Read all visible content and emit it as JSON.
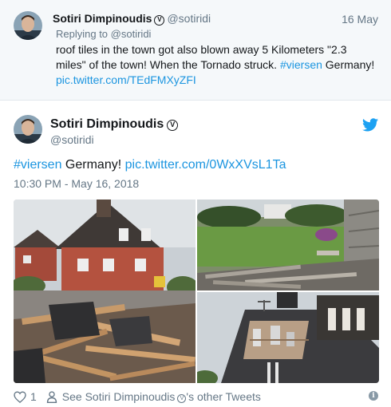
{
  "parent_tweet": {
    "author_name": "Sotiri Dimpinoudis",
    "verified_glyph": "Ⓥ",
    "author_handle": "@sotiridi",
    "date": "16 May",
    "replying_prefix": "Replying to",
    "replying_to": "@sotiridi",
    "text_line1": "roof tiles in the town got also blown away 5 Kilometers \"2.3",
    "text_line2_a": "miles\" of the town! When the Tornado struck. ",
    "hashtag": "#viersen",
    "text_line2_b": " Germany!",
    "link": "pic.twitter.com/TEdFMXyZFI"
  },
  "tweet": {
    "author_name": "Sotiri Dimpinoudis",
    "verified_glyph": "Ⓥ",
    "author_handle": "@sotiridi",
    "hashtag": "#viersen",
    "text_middle": " Germany! ",
    "link": "pic.twitter.com/0WxXVsL1Ta",
    "timestamp": "10:30 PM - May 16, 2018"
  },
  "actions": {
    "like_count": "1",
    "other_tweets_prefix": "See Sotiri Dimpinoudis",
    "other_tweets_suffix": "'s other Tweets",
    "info_glyph": "i"
  },
  "icons": {
    "like": "heart-icon",
    "user": "person-icon",
    "twitter": "twitter-bird-icon",
    "info": "info-icon"
  },
  "colors": {
    "link": "#1b95e0",
    "secondary_text": "#657786",
    "parent_background": "#f5f8fa",
    "twitter_blue": "#1da1f2"
  }
}
